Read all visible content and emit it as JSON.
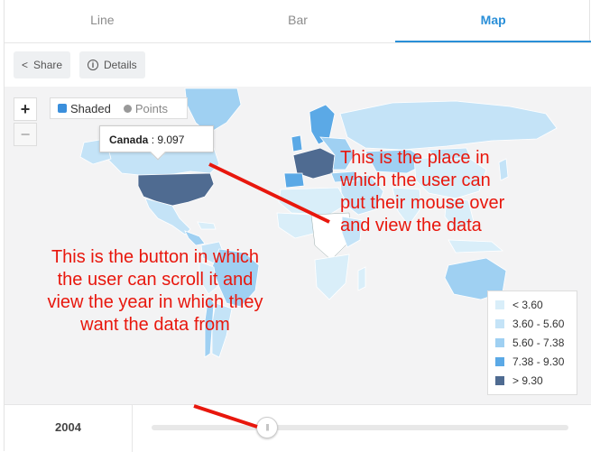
{
  "tabs": [
    {
      "label": "Line",
      "active": false
    },
    {
      "label": "Bar",
      "active": false
    },
    {
      "label": "Map",
      "active": true
    }
  ],
  "toolbar": {
    "share_label": "Share",
    "details_label": "Details"
  },
  "map": {
    "zoom_in": "+",
    "zoom_out": "−",
    "mode_shaded": "Shaded",
    "mode_points": "Points",
    "selected_mode": "Shaded",
    "tooltip": {
      "country": "Canada",
      "value": ": 9.097"
    }
  },
  "legend": [
    {
      "label": "< 3.60",
      "color": "#d9eef9"
    },
    {
      "label": "3.60 - 5.60",
      "color": "#c4e3f7"
    },
    {
      "label": "5.60 - 7.38",
      "color": "#9fd0f2"
    },
    {
      "label": "7.38 - 9.30",
      "color": "#5ba9e6"
    },
    {
      "label": "> 9.30",
      "color": "#4f6b91"
    }
  ],
  "slider": {
    "year": "2004"
  },
  "annotations": {
    "hover_note": "This is the place in which the user can put their mouse over and view the data",
    "slider_note": "This is the button in which the user can scroll it and view the year in which they want the data from"
  },
  "colors": {
    "accent": "#2a8fd8",
    "annotation": "#e8170d"
  }
}
